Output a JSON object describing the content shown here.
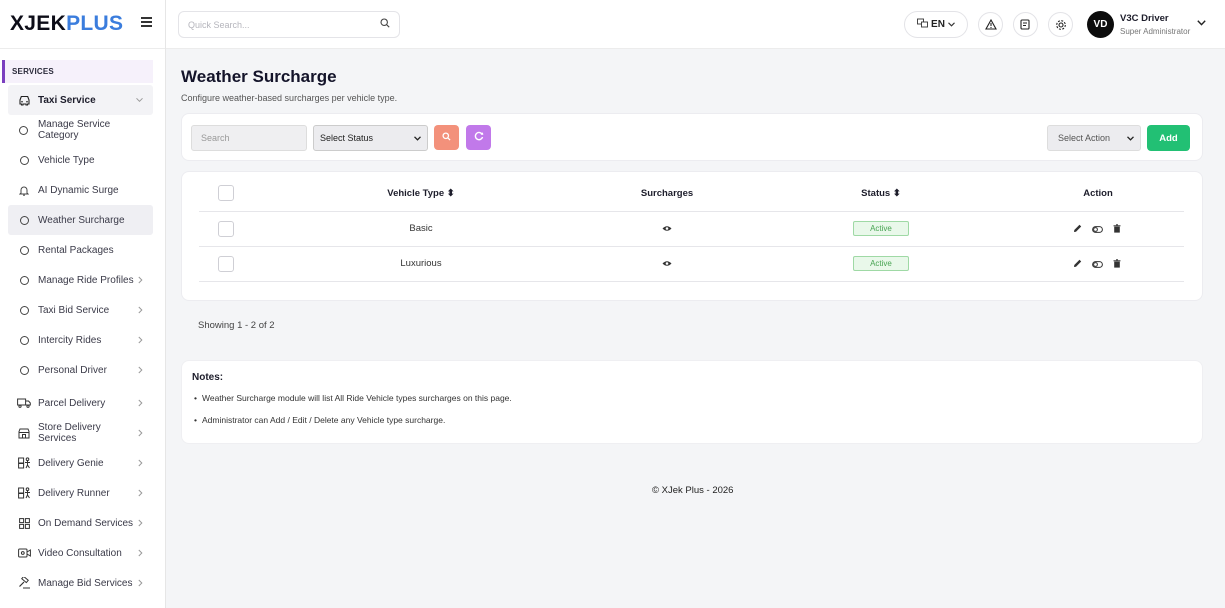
{
  "brand": {
    "part1": "XJEK",
    "part2": "PLUS"
  },
  "sidebar": {
    "section": "SERVICES",
    "items": [
      {
        "label": "Taxi Service",
        "icon": "car-icon",
        "type": "parent-open"
      },
      {
        "label": "Manage Service Category",
        "icon": "circle-icon",
        "type": "sub"
      },
      {
        "label": "Vehicle Type",
        "icon": "circle-icon",
        "type": "sub"
      },
      {
        "label": "AI Dynamic Surge",
        "icon": "bell-icon",
        "type": "sub"
      },
      {
        "label": "Weather Surcharge",
        "icon": "circle-icon",
        "type": "active"
      },
      {
        "label": "Rental Packages",
        "icon": "circle-icon",
        "type": "sub"
      },
      {
        "label": "Manage Ride Profiles",
        "icon": "circle-icon",
        "type": "sub-chev"
      },
      {
        "label": "Taxi Bid Service",
        "icon": "circle-icon",
        "type": "sub-chev"
      },
      {
        "label": "Intercity Rides",
        "icon": "circle-icon",
        "type": "sub-chev"
      },
      {
        "label": "Personal Driver",
        "icon": "circle-icon",
        "type": "sub-chev"
      },
      {
        "label": "Parcel Delivery",
        "icon": "truck-icon",
        "type": "chev"
      },
      {
        "label": "Store Delivery Services",
        "icon": "store-icon",
        "type": "chev"
      },
      {
        "label": "Delivery Genie",
        "icon": "delivery-icon",
        "type": "chev"
      },
      {
        "label": "Delivery Runner",
        "icon": "delivery-icon",
        "type": "chev"
      },
      {
        "label": "On Demand Services",
        "icon": "grid-icon",
        "type": "chev"
      },
      {
        "label": "Video Consultation",
        "icon": "video-icon",
        "type": "chev"
      },
      {
        "label": "Manage Bid Services",
        "icon": "gavel-icon",
        "type": "chev"
      }
    ]
  },
  "topbar": {
    "search_placeholder": "Quick Search...",
    "language": "EN",
    "user_initials": "VD",
    "user_name": "V3C Driver",
    "user_role": "Super Administrator"
  },
  "page": {
    "title": "Weather Surcharge",
    "subtitle": "Configure weather-based surcharges per vehicle type."
  },
  "filters": {
    "search_placeholder": "Search",
    "status_select": "Select Status",
    "action_select": "Select Action",
    "add_label": "Add"
  },
  "table": {
    "headers": {
      "vehicle_type": "Vehicle Type",
      "surcharges": "Surcharges",
      "status": "Status",
      "action": "Action"
    },
    "rows": [
      {
        "vehicle_type": "Basic",
        "status": "Active"
      },
      {
        "vehicle_type": "Luxurious",
        "status": "Active"
      }
    ],
    "showing": "Showing 1 - 2 of 2"
  },
  "notes": {
    "title": "Notes:",
    "items": [
      "Weather Surcharge module will list All Ride Vehicle types surcharges on this page.",
      "Administrator can Add / Edit / Delete any Vehicle type surcharge."
    ]
  },
  "footer": "© XJek Plus - 2026",
  "colors": {
    "accent": "#7b3fbf",
    "brand_blue": "#3b7ddd",
    "add_green": "#22c074",
    "search_btn": "#f3917b",
    "reset_btn": "#c179ea"
  }
}
